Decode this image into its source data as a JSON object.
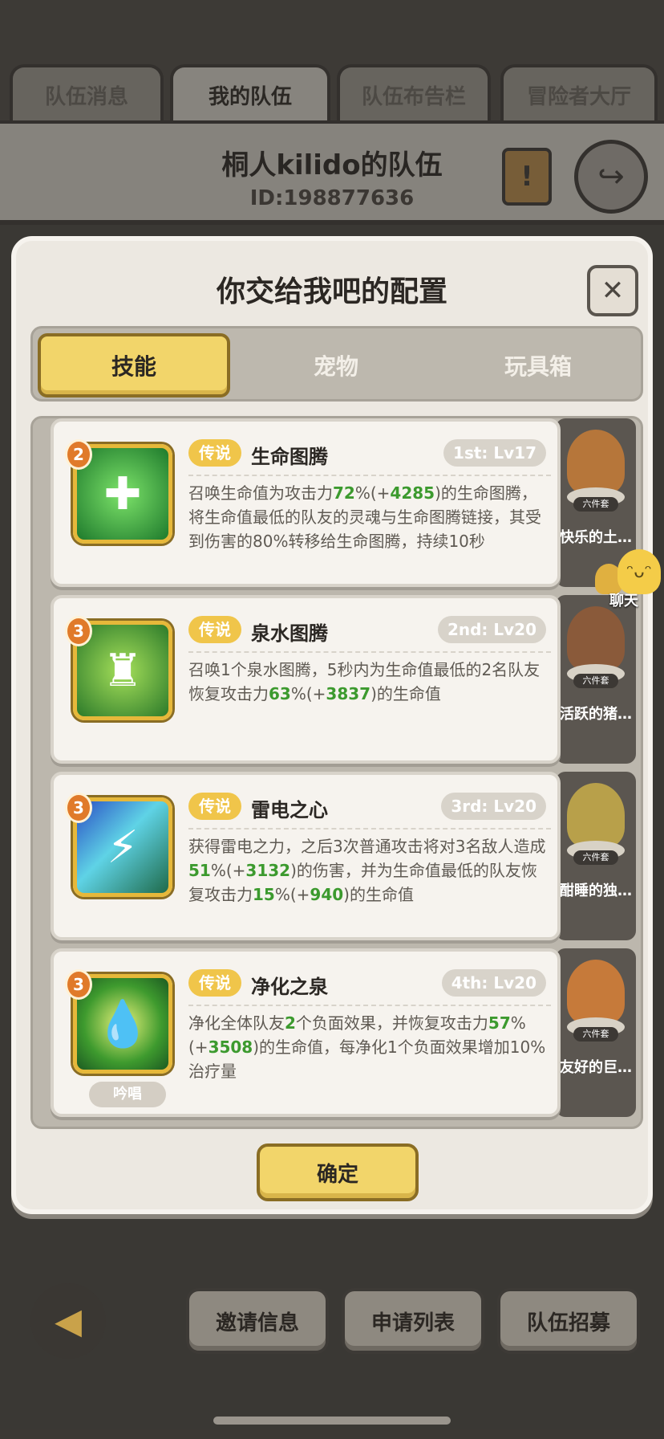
{
  "top_tabs": [
    {
      "label": "队伍消息"
    },
    {
      "label": "我的队伍"
    },
    {
      "label": "队伍布告栏"
    },
    {
      "label": "冒险者大厅"
    }
  ],
  "team": {
    "name": "桐人kilido的队伍",
    "id": "ID:198877636"
  },
  "modal": {
    "title": "你交给我吧的配置",
    "close_label": "✕",
    "segments": [
      {
        "label": "技能"
      },
      {
        "label": "宠物"
      },
      {
        "label": "玩具箱"
      }
    ],
    "confirm_label": "确定"
  },
  "skills": [
    {
      "level": "2",
      "tag": "传说",
      "name": "生命图腾",
      "slot": "1st: Lv17",
      "desc_parts": [
        "召唤生命值为攻击力",
        "72",
        "%(+",
        "4285",
        ")的生命图腾，将生命值最低的队友的灵魂与生命图腾链接，其受到伤害的80%转移给生命图腾，持续10秒"
      ],
      "icon": "totem-icon",
      "pet_name": "快乐的土…",
      "pet_badge": "六件套"
    },
    {
      "level": "3",
      "tag": "传说",
      "name": "泉水图腾",
      "slot": "2nd: Lv20",
      "desc_parts": [
        "召唤1个泉水图腾，5秒内为生命值最低的2名队友恢复攻击力",
        "63",
        "%(+",
        "3837",
        ")的生命值"
      ],
      "icon": "spring-totem-icon",
      "pet_name": "活跃的猪…",
      "pet_badge": "六件套"
    },
    {
      "level": "3",
      "tag": "传说",
      "name": "雷电之心",
      "slot": "3rd: Lv20",
      "desc_parts": [
        "获得雷电之力，之后3次普通攻击将对3名敌人造成",
        "51",
        "%(+",
        "3132",
        ")的伤害，并为生命值最低的队友恢复攻击力",
        "15",
        "%(+",
        "940",
        ")的生命值"
      ],
      "icon": "lightning-icon",
      "pet_name": "酣睡的独…",
      "pet_badge": "六件套"
    },
    {
      "level": "3",
      "tag": "传说",
      "name": "净化之泉",
      "slot": "4th: Lv20",
      "desc_parts": [
        "净化全体队友",
        "2",
        "个负面效果，并恢复攻击力",
        "57",
        "%(+",
        "3508",
        ")的生命值，每净化1个负面效果增加10%治疗量"
      ],
      "icon": "water-drop-icon",
      "chant": "吟唱",
      "pet_name": "友好的巨…",
      "pet_badge": "六件套"
    }
  ],
  "chat": {
    "label": "聊天"
  },
  "bottom_buttons": [
    {
      "label": "邀请信息"
    },
    {
      "label": "申请列表"
    },
    {
      "label": "队伍招募"
    }
  ],
  "colors": {
    "accent_yellow": "#f2d56a",
    "number_green": "#3c9a2e",
    "legend_tag": "#f0c54a"
  }
}
